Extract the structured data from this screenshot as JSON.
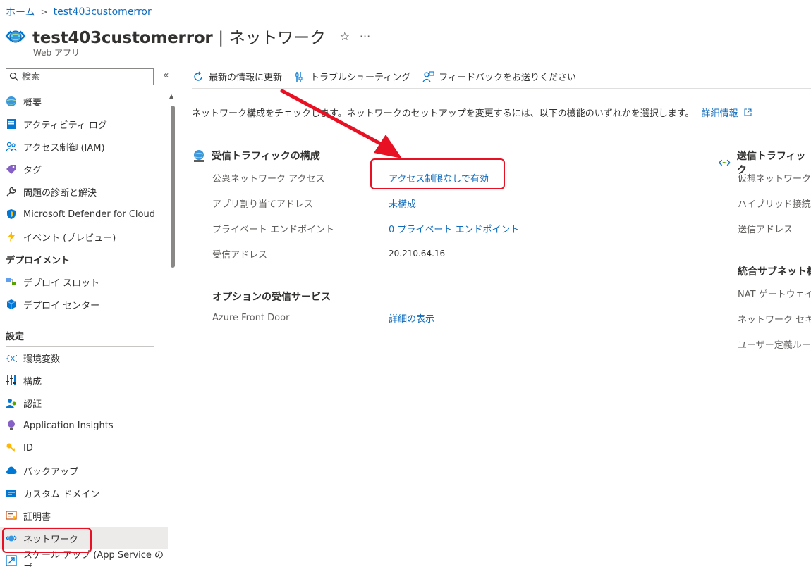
{
  "breadcrumb": {
    "home": "ホーム",
    "current": "test403customerror"
  },
  "header": {
    "resource_name": "test403customerror",
    "separator": "|",
    "section": "ネットワーク",
    "subtitle": "Web アプリ",
    "star": "☆",
    "more": "···"
  },
  "search": {
    "placeholder": "検索"
  },
  "sidebar": {
    "collapse": "«",
    "items": [
      {
        "label": "概要",
        "icon": "globe-icon"
      },
      {
        "label": "アクティビティ ログ",
        "icon": "log-icon"
      },
      {
        "label": "アクセス制御 (IAM)",
        "icon": "people-icon"
      },
      {
        "label": "タグ",
        "icon": "tag-icon"
      },
      {
        "label": "問題の診断と解決",
        "icon": "wrench-icon"
      },
      {
        "label": "Microsoft Defender for Cloud",
        "icon": "shield-icon"
      },
      {
        "label": "イベント (プレビュー)",
        "icon": "lightning-icon"
      }
    ],
    "section_deploy": "デプロイメント",
    "deploy_items": [
      {
        "label": "デプロイ スロット",
        "icon": "slots-icon"
      },
      {
        "label": "デプロイ センター",
        "icon": "cube-icon"
      }
    ],
    "section_settings": "設定",
    "settings_items": [
      {
        "label": "環境変数",
        "icon": "variable-icon"
      },
      {
        "label": "構成",
        "icon": "sliders-icon"
      },
      {
        "label": "認証",
        "icon": "auth-icon"
      },
      {
        "label": "Application Insights",
        "icon": "bulb-icon"
      },
      {
        "label": "ID",
        "icon": "key-icon"
      },
      {
        "label": "バックアップ",
        "icon": "cloud-icon"
      },
      {
        "label": "カスタム ドメイン",
        "icon": "domain-icon"
      },
      {
        "label": "証明書",
        "icon": "certificate-icon"
      },
      {
        "label": "ネットワーク",
        "icon": "network-icon"
      },
      {
        "label": "スケール アップ (App Service のプ",
        "icon": "scale-icon"
      }
    ]
  },
  "toolbar": {
    "refresh": "最新の情報に更新",
    "troubleshoot": "トラブルシューティング",
    "feedback": "フィードバックをお送りください"
  },
  "intro": {
    "text": "ネットワーク構成をチェックします。ネットワークのセットアップを変更するには、以下の機能のいずれかを選択します。",
    "link": "詳細情報"
  },
  "inbound": {
    "title": "受信トラフィックの構成",
    "rows": [
      {
        "label": "公衆ネットワーク アクセス",
        "value": "アクセス制限なしで有効"
      },
      {
        "label": "アプリ割り当てアドレス",
        "value": "未構成"
      },
      {
        "label": "プライベート エンドポイント",
        "value": "0 プライベート エンドポイント"
      },
      {
        "label": "受信アドレス",
        "value": "20.210.64.16"
      }
    ]
  },
  "optional": {
    "title": "オプションの受信サービス",
    "rows": [
      {
        "label": "Azure Front Door",
        "value": "詳細の表示"
      }
    ]
  },
  "outbound": {
    "title": "送信トラフィック",
    "rows": [
      "仮想ネットワーク",
      "ハイブリッド接続",
      "送信アドレス"
    ]
  },
  "integration": {
    "title": "統合サブネット構",
    "rows": [
      "NAT ゲートウェイ",
      "ネットワーク セキ",
      "ユーザー定義ルー"
    ]
  },
  "colors": {
    "accent": "#0f6cbd",
    "annotation": "#e81123"
  }
}
